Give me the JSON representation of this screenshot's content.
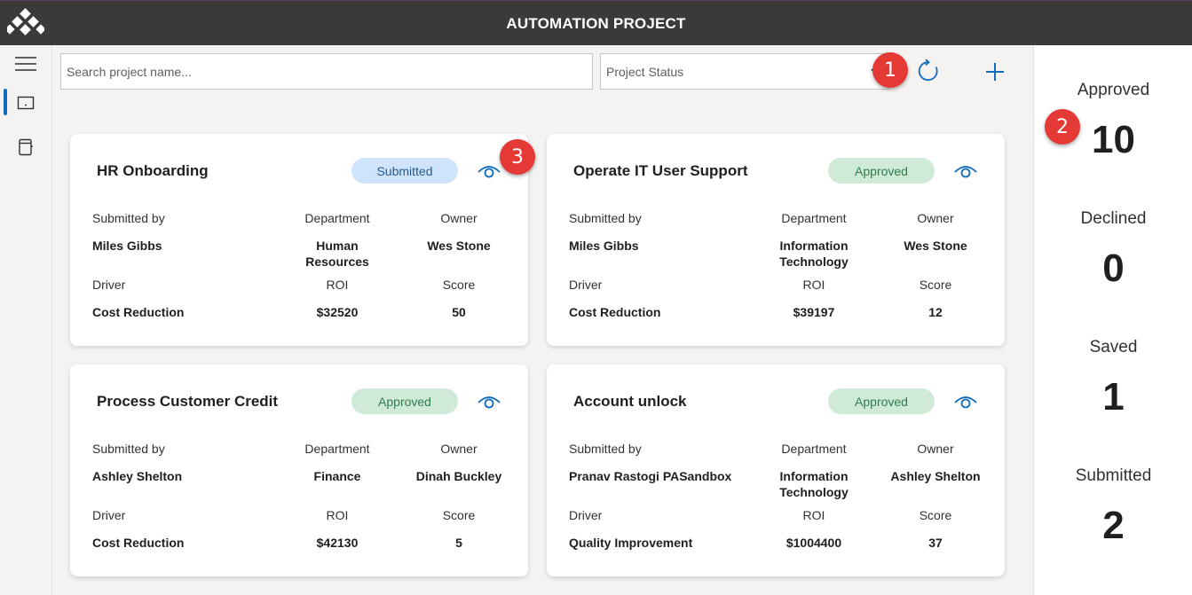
{
  "app": {
    "title": "AUTOMATION PROJECT"
  },
  "toolbar": {
    "search_placeholder": "Search project name...",
    "status_placeholder": "Project Status",
    "refresh_icon": "refresh-icon",
    "add_icon": "add-icon"
  },
  "labels": {
    "submitted_by": "Submitted by",
    "department": "Department",
    "owner": "Owner",
    "driver": "Driver",
    "roi": "ROI",
    "score": "Score"
  },
  "projects": [
    {
      "title": "HR Onboarding",
      "status": "Submitted",
      "submitted_by": "Miles Gibbs",
      "department": "Human Resources",
      "owner": "Wes Stone",
      "driver": "Cost Reduction",
      "roi": "$32520",
      "score": "50"
    },
    {
      "title": "Operate IT User Support",
      "status": "Approved",
      "submitted_by": "Miles Gibbs",
      "department": "Information Technology",
      "owner": "Wes Stone",
      "driver": "Cost Reduction",
      "roi": "$39197",
      "score": "12"
    },
    {
      "title": "Process Customer Credit",
      "status": "Approved",
      "submitted_by": "Ashley Shelton",
      "department": "Finance",
      "owner": "Dinah Buckley",
      "driver": "Cost Reduction",
      "roi": "$42130",
      "score": "5"
    },
    {
      "title": "Account unlock",
      "status": "Approved",
      "submitted_by": "Pranav Rastogi PASandbox",
      "department": "Information Technology",
      "owner": "Ashley Shelton",
      "driver": "Quality Improvement",
      "roi": "$1004400",
      "score": "37"
    }
  ],
  "stats": [
    {
      "label": "Approved",
      "value": "10"
    },
    {
      "label": "Declined",
      "value": "0"
    },
    {
      "label": "Saved",
      "value": "1"
    },
    {
      "label": "Submitted",
      "value": "2"
    }
  ],
  "callouts": [
    "1",
    "2",
    "3"
  ],
  "colors": {
    "accent": "#0f6cbd",
    "topbar": "#3b3a39",
    "callout": "#e53935",
    "submitted_pill": "#cfe4fa",
    "approved_pill": "#d0ead8"
  }
}
